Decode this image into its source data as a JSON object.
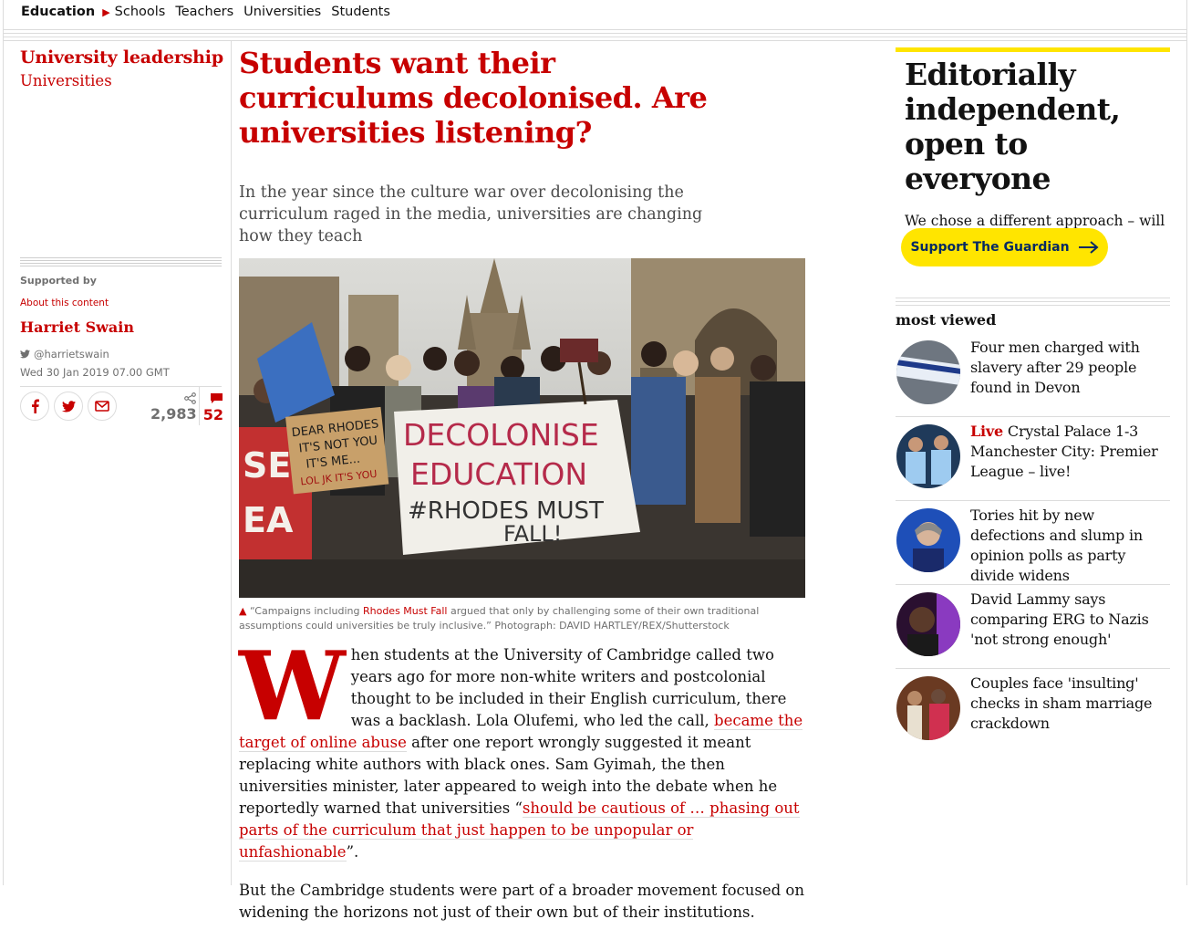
{
  "nav": {
    "section": "Education",
    "subsections": [
      "Schools",
      "Teachers",
      "Universities",
      "Students"
    ]
  },
  "sidebar": {
    "series": "University leadership",
    "tag": "Universities",
    "supported_by": "Supported by",
    "about": "About this content",
    "author": "Harriet Swain",
    "twitter": "@harrietswain",
    "date": "Wed 30 Jan 2019 07.00 GMT",
    "share_count": "2,983",
    "comment_count": "52"
  },
  "article": {
    "headline": "Students want their curriculums decolonised. Are universities listening?",
    "standfirst": "In the year since the culture war over decolonising the curriculum raged in the media, universities are changing how they teach",
    "caption": {
      "pre": "“Campaigns including ",
      "link": "Rhodes Must Fall",
      "post": " argued that only by challenging some of their own traditional assumptions could universities be truly inclusive.” Photograph: DAVID HARTLEY/REX/Shutterstock"
    },
    "banner": [
      "DECOLONISE",
      "EDUCATION",
      "#RHODES MUST",
      "FALL!"
    ],
    "sign": [
      "DEAR RHODES",
      "IT'S NOT YOU",
      "IT'S ME...",
      "LOL JK IT'S YOU"
    ],
    "dropcap": "W",
    "p1_a": "hen students at the University of Cambridge called two years ago for more non-white writers and postcolonial thought to be included in their English curriculum, there was a backlash. Lola Olufemi, who led the call, ",
    "p1_link1": "became the target of online abuse",
    "p1_b": " after one report wrongly suggested it meant replacing white authors with black ones. Sam Gyimah, the then universities minister, later appeared to weigh into the debate when he reportedly warned that universities “",
    "p1_link2": "should be cautious of … phasing out parts of the curriculum that just happen to be unpopular or unfashionable",
    "p1_c": "”.",
    "p2": "But the Cambridge students were part of a broader movement focused on widening the horizons not just of their own but of their institutions."
  },
  "support": {
    "heading": "Editorially independent, open to everyone",
    "text": "We chose a different approach – will you support it?",
    "button": "Support The Guardian"
  },
  "most_viewed": {
    "title": "most viewed",
    "items": [
      {
        "live": "",
        "text": "Four men charged with slavery after 29 people found in Devon"
      },
      {
        "live": "Live",
        "text": "Crystal Palace 1-3 Manchester City: Premier League – live!"
      },
      {
        "live": "",
        "text": "Tories hit by new defections and slump in opinion polls as party divide widens"
      },
      {
        "live": "",
        "text": "David Lammy says comparing ERG to Nazis 'not strong enough'"
      },
      {
        "live": "",
        "text": "Couples face 'insulting' checks in sham marriage crackdown"
      }
    ]
  },
  "colors": {
    "accent": "#c70000",
    "support_yellow": "#ffe500",
    "brand_blue": "#052962"
  }
}
